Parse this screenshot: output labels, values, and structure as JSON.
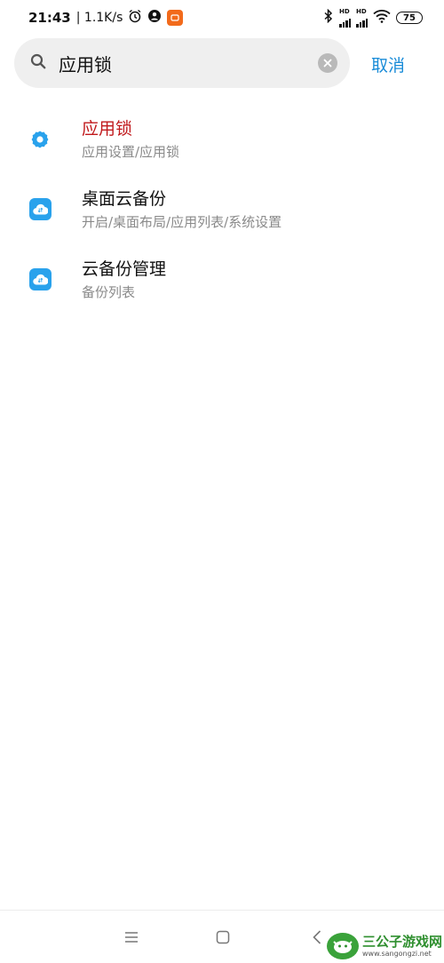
{
  "status_bar": {
    "time": "21:43",
    "net_speed": "| 1.1K/s",
    "hd1": "HD",
    "hd2": "HD",
    "battery": "75",
    "icons": [
      "alarm-icon",
      "user-location-icon",
      "app-notification-icon",
      "bluetooth-icon",
      "signal-icon",
      "wifi-icon",
      "battery-icon"
    ]
  },
  "search": {
    "query": "应用锁",
    "cancel_label": "取消"
  },
  "results": [
    {
      "title": "应用锁",
      "path": "应用设置/应用锁",
      "icon": "gear-icon",
      "highlighted": true
    },
    {
      "title": "桌面云备份",
      "path": "开启/桌面布局/应用列表/系统设置",
      "icon": "cloud-backup-icon",
      "highlighted": false
    },
    {
      "title": "云备份管理",
      "path": "备份列表",
      "icon": "cloud-backup-icon",
      "highlighted": false
    }
  ],
  "nav": {
    "buttons": [
      "menu-icon",
      "home-icon",
      "back-icon"
    ]
  },
  "watermark": {
    "name": "三公子游戏网",
    "url": "www.sangongzi.net"
  },
  "colors": {
    "highlight": "#c0191c",
    "accent": "#1a8cd8",
    "cloud_tile": "#2aa2ec",
    "gear": "#2aa2ec"
  }
}
